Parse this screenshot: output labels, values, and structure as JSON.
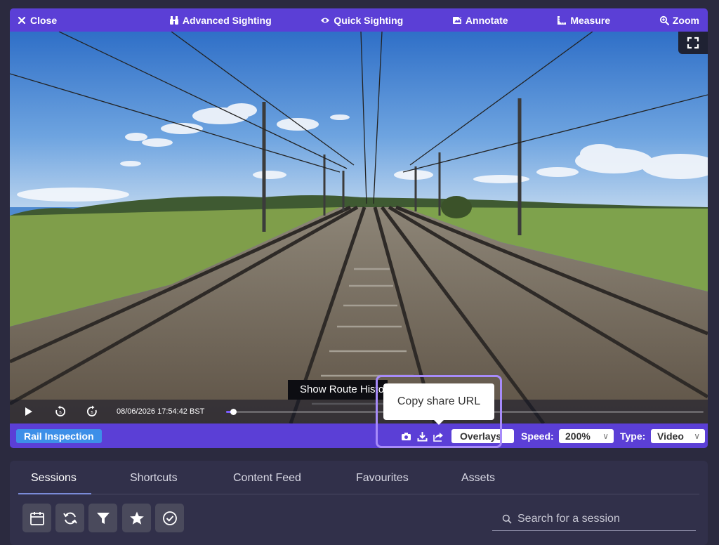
{
  "topbar": {
    "close": "Close",
    "advanced_sighting": "Advanced Sighting",
    "quick_sighting": "Quick Sighting",
    "annotate": "Annotate",
    "measure": "Measure",
    "zoom": "Zoom"
  },
  "player": {
    "timestamp": "08/06/2026 17:54:42 BST",
    "progress_fraction": 0.015,
    "route_tooltip": "Show Route History",
    "share_tooltip": "Copy share URL"
  },
  "bottombar": {
    "badge": "Rail Inspection",
    "overlays_label": "Overlays",
    "speed_label": "Speed:",
    "speed_value": "200%",
    "type_label": "Type:",
    "type_value": "Video"
  },
  "panel": {
    "tabs": [
      "Sessions",
      "Shortcuts",
      "Content Feed",
      "Favourites",
      "Assets"
    ],
    "active_tab": "Sessions",
    "search_placeholder": "Search for a session"
  },
  "colors": {
    "accent": "#5b3fd6",
    "badge": "#3d8fe8",
    "highlight": "#a78bfa",
    "panel_bg": "#31304a"
  },
  "icons": [
    "close-icon",
    "binoculars-icon",
    "eye-icon",
    "annotate-icon",
    "ruler-icon",
    "zoom-icon",
    "fullscreen-icon",
    "play-icon",
    "rewind-icon",
    "forward-icon",
    "camera-icon",
    "download-icon",
    "share-icon",
    "calendar-icon",
    "refresh-icon",
    "filter-icon",
    "star-icon",
    "check-circle-icon",
    "search-icon"
  ]
}
